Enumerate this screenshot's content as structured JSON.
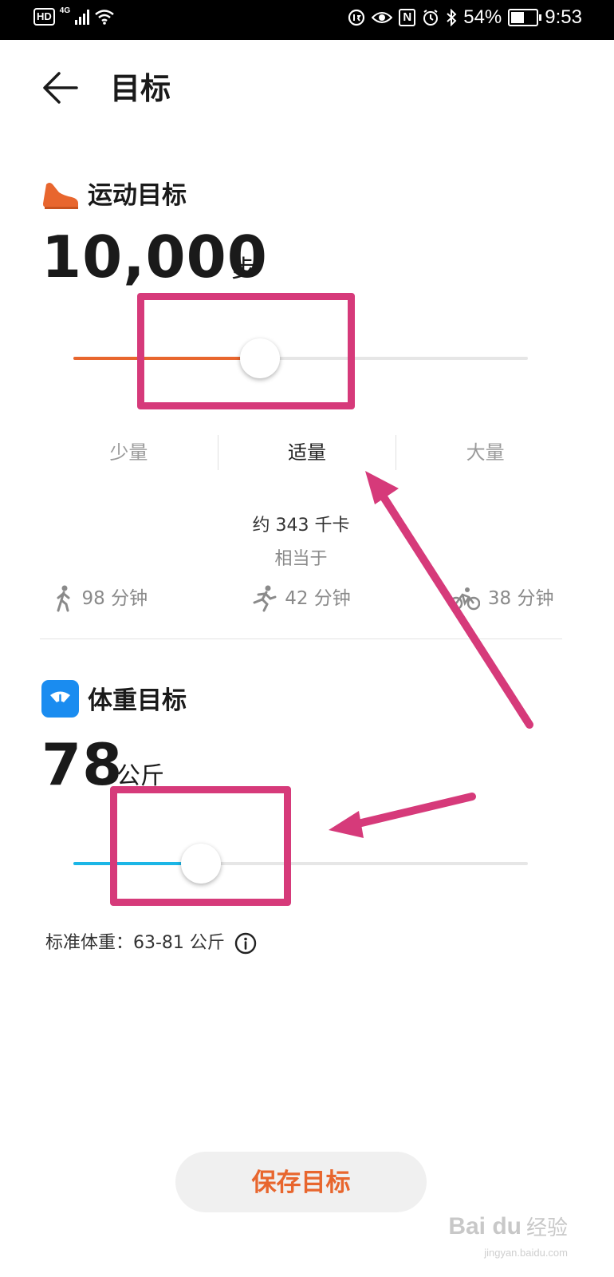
{
  "status_bar": {
    "hd": "HD",
    "network": "4G",
    "battery_percent": "54%",
    "time": "9:53",
    "battery_level": 0.54
  },
  "header": {
    "title": "目标"
  },
  "activity_goal": {
    "section_title": "运动目标",
    "value": "10,000",
    "unit": "步",
    "slider_level": 0.41,
    "accent_color": "#e8662e",
    "levels": [
      "少量",
      "适量",
      "大量"
    ],
    "selected_level": "适量",
    "calories_text": "约 343 千卡",
    "equivalent_label": "相当于",
    "equivalents": [
      {
        "icon": "walking-icon",
        "text": "98 分钟"
      },
      {
        "icon": "running-icon",
        "text": "42 分钟"
      },
      {
        "icon": "cycling-icon",
        "text": "38 分钟"
      }
    ]
  },
  "weight_goal": {
    "section_title": "体重目标",
    "value": "78",
    "unit": "公斤",
    "slider_level": 0.28,
    "accent_color": "#1bb6e6",
    "standard_weight": "标准体重：63-81 公斤"
  },
  "save_button": {
    "label": "保存目标"
  },
  "watermark": {
    "logo": "Bai du",
    "text": "经验",
    "url": "jingyan.baidu.com"
  }
}
